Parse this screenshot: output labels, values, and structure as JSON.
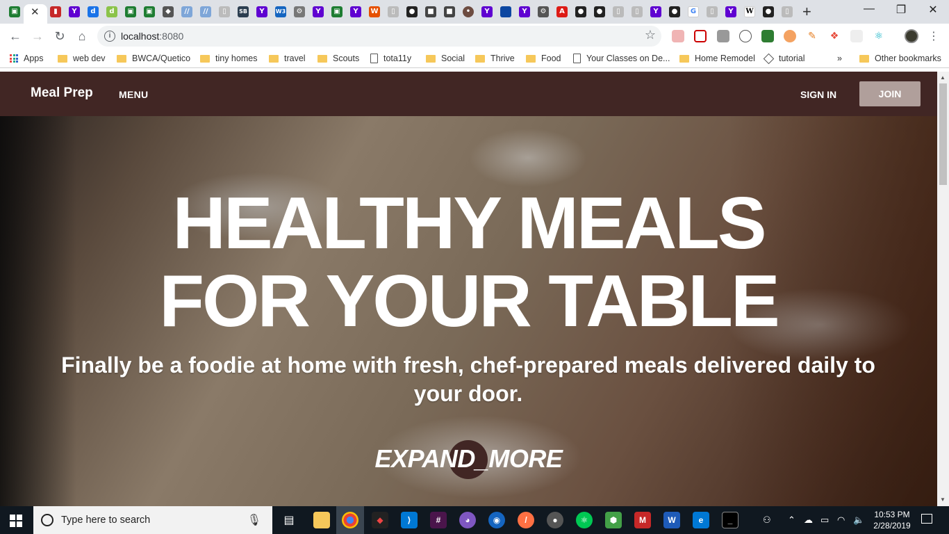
{
  "browser": {
    "url_host": "localhost",
    "url_port": ":8080",
    "tab_close_glyph": "✕",
    "new_tab_glyph": "+",
    "window_controls": {
      "minimize": "—",
      "restore": "❐",
      "close": "✕"
    },
    "bookmarks": {
      "apps": "Apps",
      "items": [
        "web dev",
        "BWCA/Quetico",
        "tiny homes",
        "travel",
        "Scouts",
        "tota11y",
        "Social",
        "Thrive",
        "Food",
        "Your Classes on De...",
        "Home Remodel",
        "tutorial"
      ],
      "overflow": "»",
      "other": "Other bookmarks"
    }
  },
  "app": {
    "brand": "Meal Prep",
    "menu_label": "MENU",
    "signin_label": "SIGN IN",
    "join_label": "JOIN",
    "hero": {
      "headline_line1": "HEALTHY MEALS",
      "headline_line2": "FOR YOUR TABLE",
      "subline": "Finally be a foodie at home with fresh, chef-prepared meals delivered daily to your door.",
      "expand_label": "EXPAND_MORE"
    }
  },
  "taskbar": {
    "search_placeholder": "Type here to search",
    "time": "10:53 PM",
    "date": "2/28/2019"
  }
}
